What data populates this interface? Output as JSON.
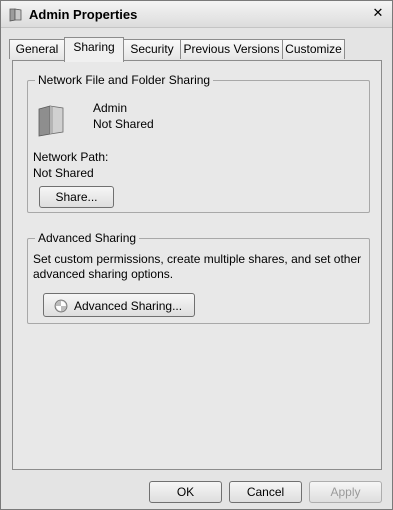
{
  "window": {
    "title": "Admin Properties",
    "close_glyph": "✕"
  },
  "tabs": [
    {
      "label": "General"
    },
    {
      "label": "Sharing",
      "active": true
    },
    {
      "label": "Security"
    },
    {
      "label": "Previous Versions"
    },
    {
      "label": "Customize"
    }
  ],
  "network_sharing": {
    "group_title": "Network File and Folder Sharing",
    "folder_name": "Admin",
    "folder_status": "Not Shared",
    "path_label": "Network Path:",
    "path_value": "Not Shared",
    "share_button": "Share..."
  },
  "advanced_sharing": {
    "group_title": "Advanced Sharing",
    "description_line1": "Set custom permissions, create multiple shares, and set other",
    "description_line2": "advanced sharing options.",
    "button_label": "Advanced Sharing..."
  },
  "footer": {
    "ok": "OK",
    "cancel": "Cancel",
    "apply": "Apply"
  },
  "icons": {
    "title": "folder-icon",
    "folder": "folder-icon",
    "advanced": "shield-icon"
  }
}
